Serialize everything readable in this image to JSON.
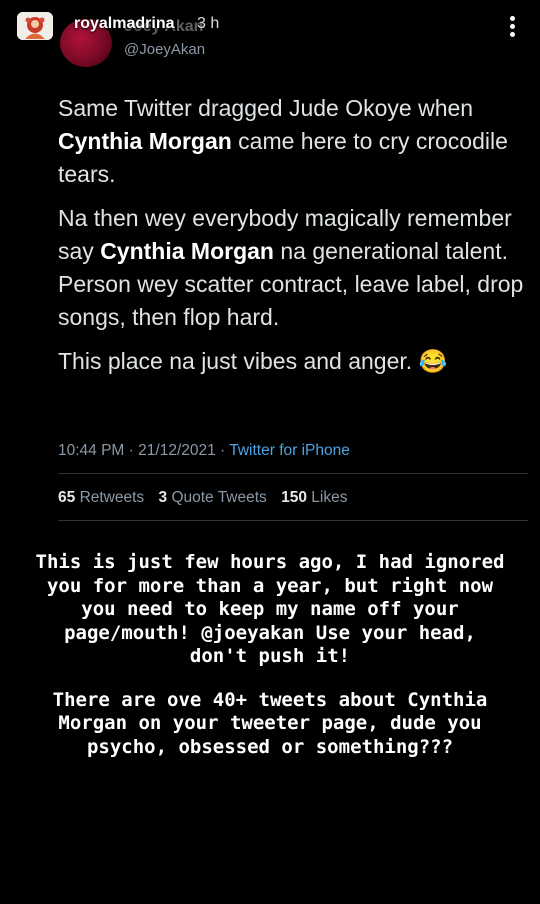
{
  "story": {
    "username": "royalmadrina",
    "time": "3 h"
  },
  "tweet": {
    "display_name": "Joey Akan",
    "handle": "@JoeyAkan",
    "paragraphs": [
      [
        "Same Twitter dragged Jude Okoye when ",
        "Cynthia Morgan",
        " came here to cry crocodile tears."
      ],
      [
        "Na then wey everybody magically remember say ",
        "Cynthia Morgan",
        " na generational talent. Person wey scatter contract, leave label, drop songs, then flop hard."
      ],
      [
        "This place na just vibes and anger. ",
        "",
        "😂"
      ]
    ],
    "meta": {
      "time": "10:44 PM",
      "date": "21/12/2021",
      "separator": "·",
      "source": "Twitter for iPhone"
    },
    "stats": {
      "retweets_count": "65",
      "retweets_label": "Retweets",
      "quotes_count": "3",
      "quotes_label": "Quote Tweets",
      "likes_count": "150",
      "likes_label": "Likes"
    }
  },
  "caption": {
    "paragraph_1": "This is just few hours ago, I had ignored you for more than a year, but right now you need to keep my name off your page/mouth! @joeyakan Use your head, don't push it!",
    "paragraph_2": "There are ove 40+ tweets about Cynthia Morgan on your tweeter page, dude you psycho, obsessed or something???"
  },
  "colors": {
    "background": "#000000",
    "link": "#4ba3e3",
    "muted": "#8b98a5"
  },
  "icons": {
    "more": "more-vertical-icon",
    "story_avatar": "avatar"
  }
}
